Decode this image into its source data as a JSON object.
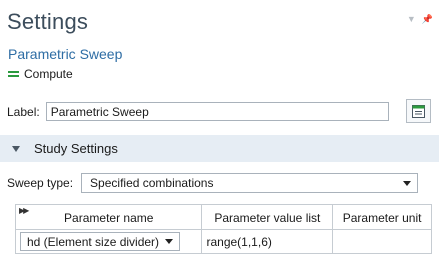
{
  "header": {
    "title": "Settings",
    "subtitle": "Parametric Sweep",
    "compute_label": "Compute"
  },
  "label_field": {
    "label": "Label:",
    "value": "Parametric Sweep"
  },
  "section": {
    "title": "Study Settings"
  },
  "sweep": {
    "label": "Sweep type:",
    "selected": "Specified combinations"
  },
  "table": {
    "columns": [
      "Parameter name",
      "Parameter value list",
      "Parameter unit"
    ],
    "rows": [
      {
        "name": "hd (Element size divider)",
        "values": "range(1,1,6)",
        "unit": ""
      }
    ]
  },
  "colors": {
    "title": "#3c4d5c",
    "subtitle": "#2e6da4",
    "compute_icon": "#2b9a3e",
    "section_bg": "#e6edf4"
  },
  "icons": [
    "pin-icon",
    "compute-icon",
    "label-edit-icon",
    "collapse-triangle-icon",
    "dropdown-caret-icon",
    "sort-arrows-icon"
  ]
}
